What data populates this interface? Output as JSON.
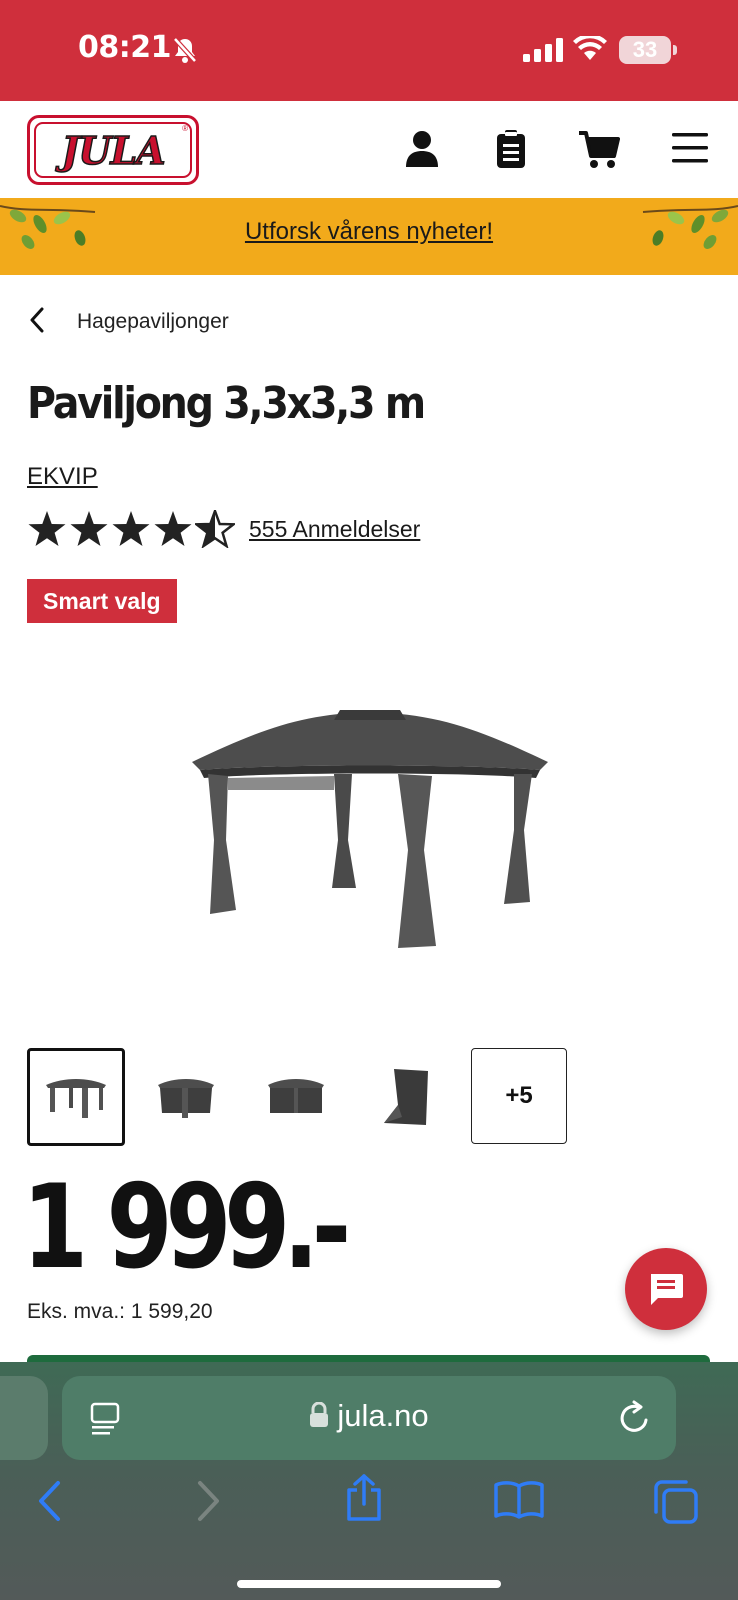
{
  "status_bar": {
    "time": "08:21",
    "battery": "33"
  },
  "header": {
    "logo_text": "JULA",
    "logo_mark": "®"
  },
  "promo": {
    "link_text": "Utforsk vårens nyheter!"
  },
  "breadcrumb": {
    "label": "Hagepaviljonger"
  },
  "product": {
    "title": "Paviljong 3,3x3,3 m",
    "brand": "EKVIP",
    "rating": 4.5,
    "reviews_link": "555 Anmeldelser",
    "badge": "Smart valg",
    "more_images_label": "+5",
    "price": "1 999.-",
    "ex_vat": "Eks. mva.: 1 599,20"
  },
  "browser": {
    "url": "jula.no"
  },
  "colors": {
    "brand_red": "#cf2f3c",
    "promo_yellow": "#f2aa1b",
    "cta_green": "#1e6b3d",
    "ios_blue": "#2f7cf6"
  },
  "icons": [
    "bell-slash-icon",
    "signal-icon",
    "wifi-icon",
    "user-icon",
    "clipboard-icon",
    "cart-icon",
    "menu-icon",
    "chevron-left-icon",
    "star-icon",
    "chat-icon",
    "reader-icon",
    "lock-icon",
    "reload-icon",
    "back-icon",
    "forward-icon",
    "share-icon",
    "bookmarks-icon",
    "tabs-icon"
  ]
}
